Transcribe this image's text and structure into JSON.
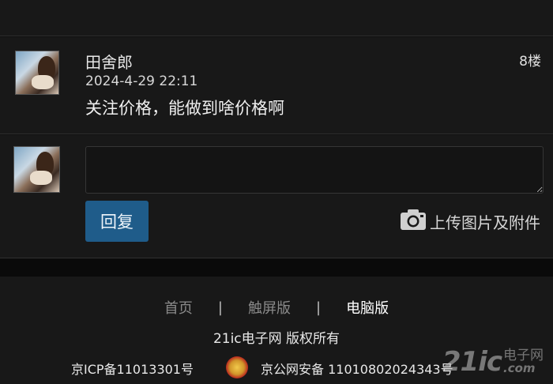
{
  "post": {
    "author": "田舍郎",
    "floor": "8楼",
    "time": "2024-4-29 22:11",
    "content": "关注价格，能做到啥价格啊"
  },
  "reply": {
    "input_value": "",
    "button_label": "回复",
    "upload_label": "上传图片及附件",
    "upload_icon": "camera-icon"
  },
  "footer": {
    "nav": [
      {
        "label": "首页",
        "active": false
      },
      {
        "label": "触屏版",
        "active": false
      },
      {
        "label": "电脑版",
        "active": true
      }
    ],
    "separator": "|",
    "copyright": "21ic电子网 版权所有",
    "icp": "京ICP备11013301号",
    "police": "京公网安备 11010802024343号"
  },
  "watermark": {
    "logo": "21ic",
    "cn": "电子网",
    "com": ".com"
  },
  "colors": {
    "background": "#0f0f0f",
    "panel": "#181818",
    "accent": "#1f5c8a"
  }
}
